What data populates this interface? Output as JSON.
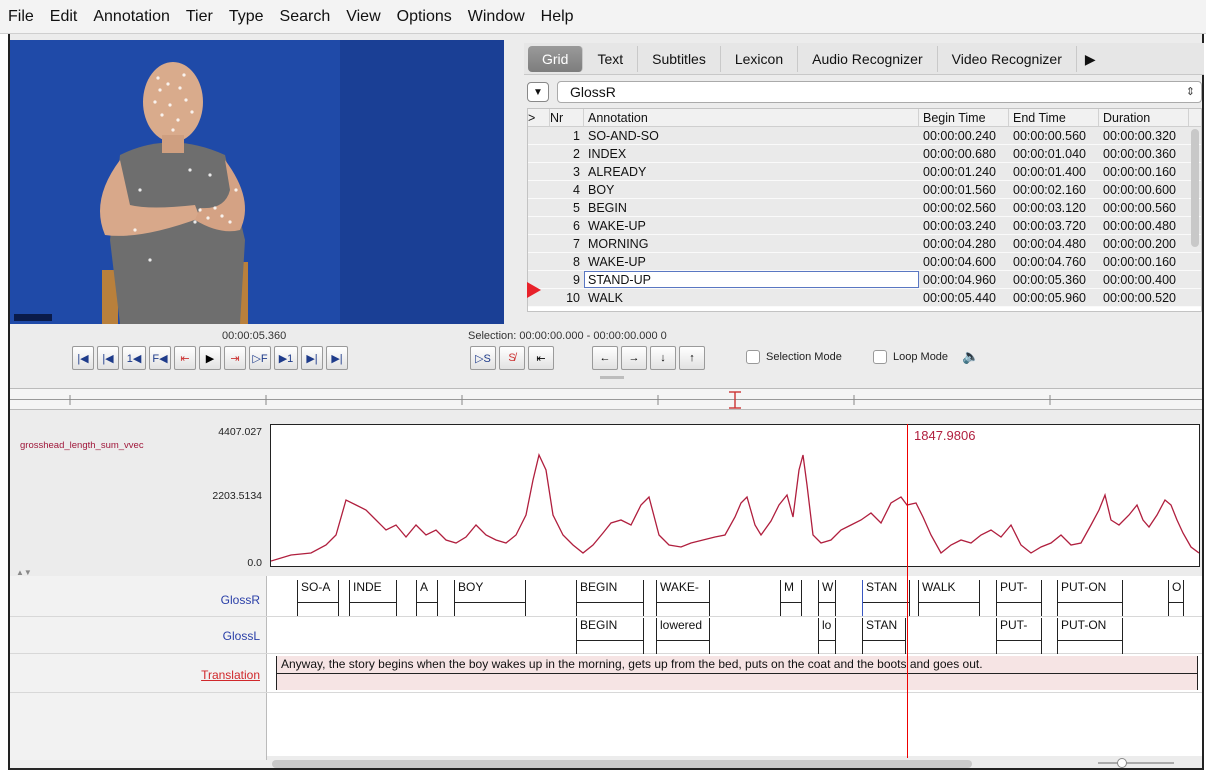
{
  "menu": [
    "File",
    "Edit",
    "Annotation",
    "Tier",
    "Type",
    "Search",
    "View",
    "Options",
    "Window",
    "Help"
  ],
  "tabs": [
    {
      "label": "Grid",
      "active": true
    },
    {
      "label": "Text"
    },
    {
      "label": "Subtitles"
    },
    {
      "label": "Lexicon"
    },
    {
      "label": "Audio Recognizer"
    },
    {
      "label": "Video Recognizer"
    }
  ],
  "tier_select": {
    "value": "GlossR"
  },
  "grid": {
    "columns": [
      ">",
      "Nr",
      "Annotation",
      "Begin Time",
      "End Time",
      "Duration"
    ],
    "rows": [
      {
        "nr": "1",
        "annotation": "SO-AND-SO",
        "begin": "00:00:00.240",
        "end": "00:00:00.560",
        "duration": "00:00:00.320"
      },
      {
        "nr": "2",
        "annotation": "INDEX",
        "begin": "00:00:00.680",
        "end": "00:00:01.040",
        "duration": "00:00:00.360"
      },
      {
        "nr": "3",
        "annotation": "ALREADY",
        "begin": "00:00:01.240",
        "end": "00:00:01.400",
        "duration": "00:00:00.160"
      },
      {
        "nr": "4",
        "annotation": "BOY",
        "begin": "00:00:01.560",
        "end": "00:00:02.160",
        "duration": "00:00:00.600"
      },
      {
        "nr": "5",
        "annotation": "BEGIN",
        "begin": "00:00:02.560",
        "end": "00:00:03.120",
        "duration": "00:00:00.560"
      },
      {
        "nr": "6",
        "annotation": "WAKE-UP",
        "begin": "00:00:03.240",
        "end": "00:00:03.720",
        "duration": "00:00:00.480"
      },
      {
        "nr": "7",
        "annotation": "MORNING",
        "begin": "00:00:04.280",
        "end": "00:00:04.480",
        "duration": "00:00:00.200"
      },
      {
        "nr": "8",
        "annotation": "WAKE-UP",
        "begin": "00:00:04.600",
        "end": "00:00:04.760",
        "duration": "00:00:00.160"
      },
      {
        "nr": "9",
        "annotation": "STAND-UP",
        "begin": "00:00:04.960",
        "end": "00:00:05.360",
        "duration": "00:00:00.400",
        "selected": true
      },
      {
        "nr": "10",
        "annotation": "WALK",
        "begin": "00:00:05.440",
        "end": "00:00:05.960",
        "duration": "00:00:00.520"
      }
    ]
  },
  "transport": {
    "current_time": "00:00:05.360",
    "selection": "Selection: 00:00:00.000 - 00:00:00.000  0",
    "selection_mode_label": "Selection Mode",
    "loop_mode_label": "Loop Mode"
  },
  "signal": {
    "name": "grosshead_length_sum_vvec",
    "y_max": "4407.027",
    "y_mid": "2203.5134",
    "y_min": "0.0",
    "cursor_value": "1847.9806",
    "line_color": "#b01f3e"
  },
  "tiers": [
    {
      "name": "GlossR",
      "annotations": [
        "SO-A",
        "INDE",
        "A",
        "BOY",
        "BEGIN",
        "WAKE-",
        "M",
        "W",
        "STAN",
        "WALK",
        "PUT-",
        "PUT-ON",
        "O"
      ]
    },
    {
      "name": "GlossL",
      "annotations": [
        "BEGIN",
        "lowered",
        "lo",
        "STAN",
        "PUT-",
        "PUT-ON"
      ]
    },
    {
      "name": "Translation",
      "annotations": [
        "Anyway, the story begins when the boy wakes up in the morning, gets up from the bed, puts on the coat and the boots and goes out."
      ]
    }
  ]
}
